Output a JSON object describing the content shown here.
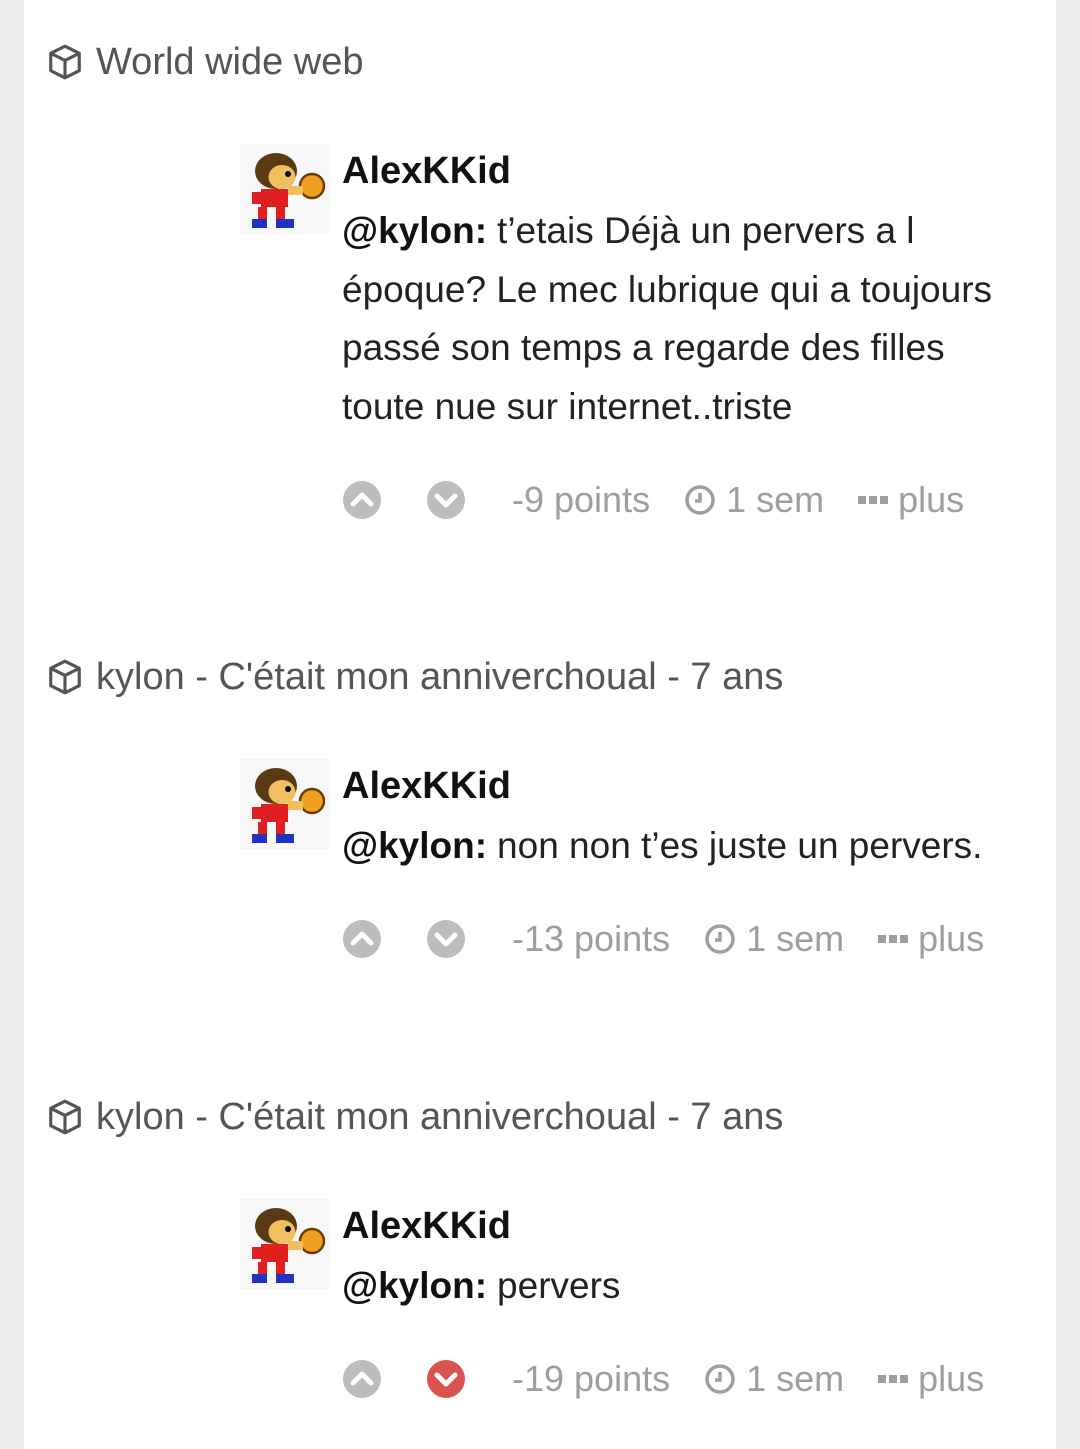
{
  "threads": [
    {
      "header": "World wide web",
      "comment": {
        "author": "AlexKKid",
        "mention": "@kylon:",
        "text": "t’etais Déjà un pervers a l époque? Le mec lubrique qui a toujours passé son temps a regarde des filles toute nue sur internet..triste",
        "points": "-9 points",
        "time": "1 sem",
        "more": "plus",
        "downvoted": false
      }
    },
    {
      "header": "kylon - C'était mon anniverchoual - 7 ans",
      "comment": {
        "author": "AlexKKid",
        "mention": "@kylon:",
        "text": "non non t’es juste un pervers.",
        "points": "-13 points",
        "time": "1 sem",
        "more": "plus",
        "downvoted": false
      }
    },
    {
      "header": "kylon - C'était mon anniverchoual - 7 ans",
      "comment": {
        "author": "AlexKKid",
        "mention": "@kylon:",
        "text": "pervers",
        "points": "-19 points",
        "time": "1 sem",
        "more": "plus",
        "downvoted": true
      }
    }
  ],
  "icons": {
    "thread": "box-icon",
    "upvote": "chevron-up-circle-icon",
    "downvote": "chevron-down-circle-icon",
    "time": "clock-icon",
    "more": "ellipsis-icon"
  },
  "colors": {
    "vote_inactive": "#bdbdbd",
    "vote_downvoted": "#d9534f",
    "meta_text": "#9e9e9e"
  }
}
